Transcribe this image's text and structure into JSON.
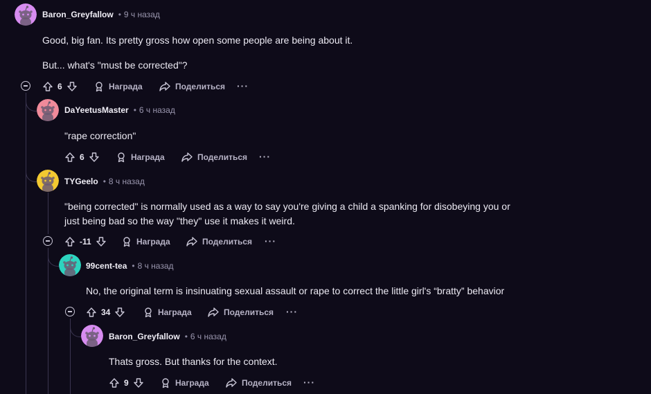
{
  "colors": {
    "background": "#0e0b19",
    "thread_line": "#3a3550",
    "avatar_purple": "#d78cf0",
    "avatar_pink": "#f08a9a",
    "avatar_yellow": "#f2c931",
    "avatar_teal": "#2dd4bf"
  },
  "actions": {
    "award_label": "Награда",
    "share_label": "Поделиться",
    "more_label": "···"
  },
  "comments": [
    {
      "author": "Baron_Greyfallow",
      "time": "9 ч назад",
      "lines": [
        "Good, big fan. Its pretty gross how open some people are being about it.",
        "But... what's \"must be corrected\"?"
      ],
      "score": "6",
      "avatar_icon": "snoo-avatar-icon"
    },
    {
      "author": "DaYeetusMaster",
      "time": "6 ч назад",
      "lines": [
        "\"rape correction\""
      ],
      "score": "6",
      "avatar_icon": "snoo-avatar-icon"
    },
    {
      "author": "TYGeelo",
      "time": "8 ч назад",
      "lines": [
        "\"being corrected\" is normally used as a way to say you're giving a child a spanking for disobeying you or",
        "just being bad so the way \"they\" use it makes it weird."
      ],
      "score": "-11",
      "avatar_icon": "snoo-avatar-icon"
    },
    {
      "author": "99cent-tea",
      "time": "8 ч назад",
      "lines": [
        "No, the original term is insinuating sexual assault or rape to correct the little girl's “bratty” behavior"
      ],
      "score": "34",
      "avatar_icon": "snoo-avatar-icon"
    },
    {
      "author": "Baron_Greyfallow",
      "time": "6 ч назад",
      "lines": [
        "Thats gross. But thanks for the context."
      ],
      "score": "9",
      "avatar_icon": "snoo-avatar-icon"
    }
  ]
}
